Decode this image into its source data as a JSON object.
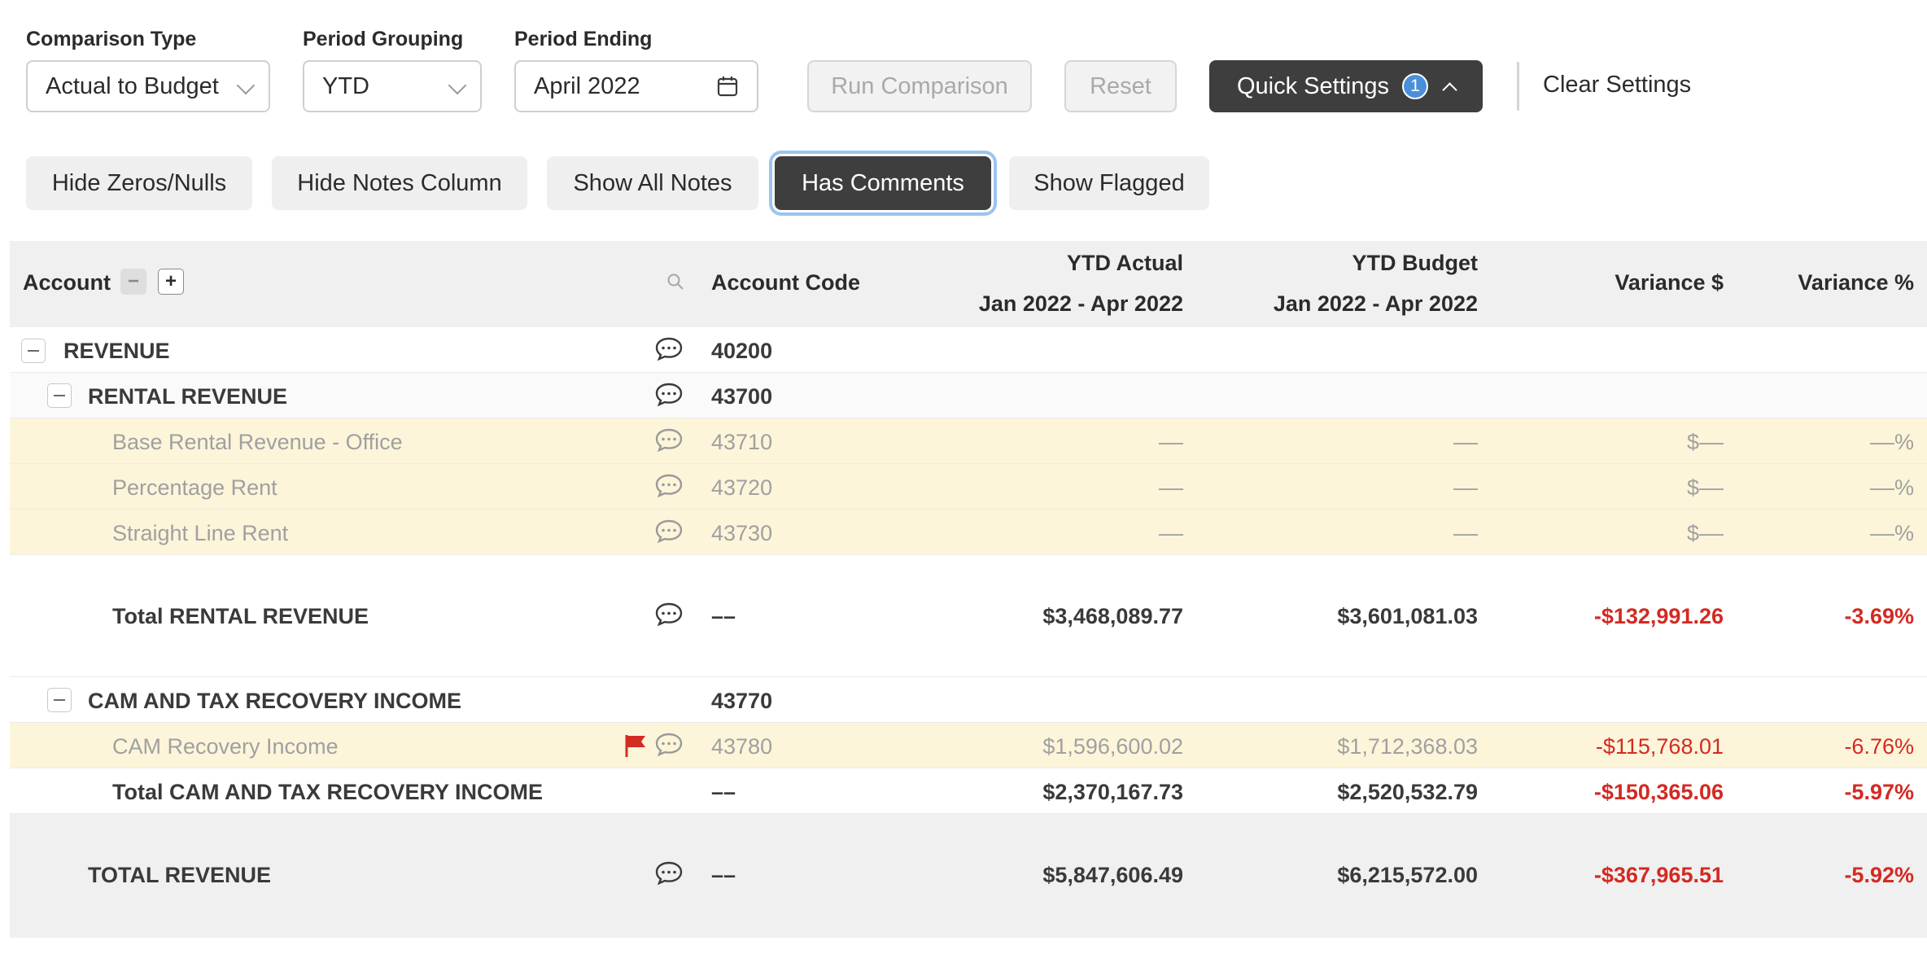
{
  "filters": {
    "comparison_type": {
      "label": "Comparison Type",
      "value": "Actual to Budget"
    },
    "period_grouping": {
      "label": "Period Grouping",
      "value": "YTD"
    },
    "period_ending": {
      "label": "Period Ending",
      "value": "April 2022"
    },
    "run_label": "Run Comparison",
    "reset_label": "Reset",
    "quick_settings_label": "Quick Settings",
    "quick_settings_count": "1",
    "clear_settings_label": "Clear Settings"
  },
  "toggles": [
    {
      "label": "Hide Zeros/Nulls",
      "active": false
    },
    {
      "label": "Hide Notes Column",
      "active": false
    },
    {
      "label": "Show All Notes",
      "active": false
    },
    {
      "label": "Has Comments",
      "active": true
    },
    {
      "label": "Show Flagged",
      "active": false
    }
  ],
  "table": {
    "headers": {
      "account": "Account",
      "account_code": "Account Code",
      "ytd_actual": "YTD Actual",
      "ytd_actual_range": "Jan 2022 - Apr 2022",
      "ytd_budget": "YTD Budget",
      "ytd_budget_range": "Jan 2022 - Apr 2022",
      "variance_amt": "Variance $",
      "variance_pct": "Variance %"
    },
    "rows": [
      {
        "account": "REVENUE",
        "code": "40200",
        "actual": "",
        "budget": "",
        "var_amt": "",
        "var_pct": ""
      },
      {
        "account": "RENTAL REVENUE",
        "code": "43700",
        "actual": "",
        "budget": "",
        "var_amt": "",
        "var_pct": ""
      },
      {
        "account": "Base Rental Revenue - Office",
        "code": "43710",
        "actual": "––",
        "budget": "––",
        "var_amt": "$––",
        "var_pct": "––%"
      },
      {
        "account": "Percentage Rent",
        "code": "43720",
        "actual": "––",
        "budget": "––",
        "var_amt": "$––",
        "var_pct": "––%"
      },
      {
        "account": "Straight Line Rent",
        "code": "43730",
        "actual": "––",
        "budget": "––",
        "var_amt": "$––",
        "var_pct": "––%"
      },
      {
        "account": "Total RENTAL REVENUE",
        "code": "––",
        "actual": "$3,468,089.77",
        "budget": "$3,601,081.03",
        "var_amt": "-$132,991.26",
        "var_pct": "-3.69%"
      },
      {
        "account": "CAM AND TAX RECOVERY INCOME",
        "code": "43770",
        "actual": "",
        "budget": "",
        "var_amt": "",
        "var_pct": ""
      },
      {
        "account": "CAM Recovery Income",
        "code": "43780",
        "actual": "$1,596,600.02",
        "budget": "$1,712,368.03",
        "var_amt": "-$115,768.01",
        "var_pct": "-6.76%"
      },
      {
        "account": "Total CAM AND TAX RECOVERY INCOME",
        "code": "––",
        "actual": "$2,370,167.73",
        "budget": "$2,520,532.79",
        "var_amt": "-$150,365.06",
        "var_pct": "-5.97%"
      },
      {
        "account": "TOTAL REVENUE",
        "code": "––",
        "actual": "$5,847,606.49",
        "budget": "$6,215,572.00",
        "var_amt": "-$367,965.51",
        "var_pct": "-5.92%"
      }
    ]
  },
  "colors": {
    "negative": "#d32a22",
    "highlight_row": "#fcf5da",
    "dark_button": "#3e3e3e",
    "badge": "#4a90d9"
  },
  "icons": [
    "chevron-down-icon",
    "calendar-icon",
    "chevron-up-icon",
    "search-icon",
    "comment-icon",
    "flag-icon",
    "collapse-icon",
    "expand-icon"
  ]
}
